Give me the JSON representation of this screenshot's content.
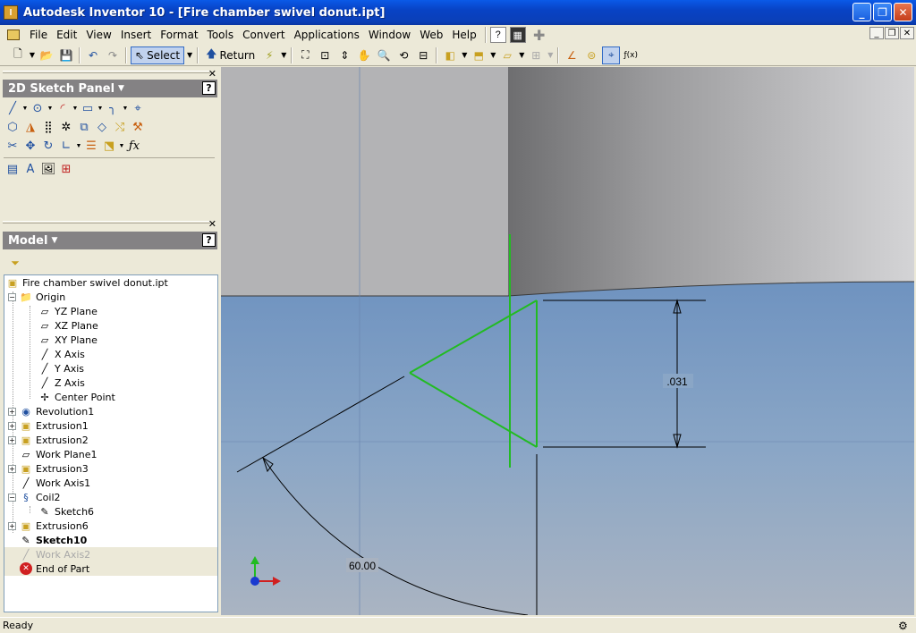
{
  "window": {
    "title": "Autodesk Inventor 10 - [Fire chamber swivel donut.ipt]",
    "controls": [
      "_",
      "❐",
      "✕"
    ]
  },
  "menu": {
    "items": [
      "File",
      "Edit",
      "View",
      "Insert",
      "Format",
      "Tools",
      "Convert",
      "Applications",
      "Window",
      "Web",
      "Help"
    ],
    "mdi_controls": [
      "_",
      "❐",
      "✕"
    ]
  },
  "toolbar": {
    "select_label": "Select",
    "return_label": "Return"
  },
  "sketch_panel": {
    "title": "2D Sketch Panel",
    "help": "?"
  },
  "model_panel": {
    "title": "Model",
    "help": "?"
  },
  "tree": [
    {
      "label": "Fire chamber swivel donut.ipt",
      "icon": "part-icon"
    },
    {
      "label": "Origin",
      "icon": "folder-icon"
    },
    {
      "label": "YZ Plane",
      "icon": "plane-icon"
    },
    {
      "label": "XZ Plane",
      "icon": "plane-icon"
    },
    {
      "label": "XY Plane",
      "icon": "plane-icon"
    },
    {
      "label": "X Axis",
      "icon": "axis-icon"
    },
    {
      "label": "Y Axis",
      "icon": "axis-icon"
    },
    {
      "label": "Z Axis",
      "icon": "axis-icon"
    },
    {
      "label": "Center Point",
      "icon": "point-icon"
    },
    {
      "label": "Revolution1",
      "icon": "revolve-icon"
    },
    {
      "label": "Extrusion1",
      "icon": "extrude-icon"
    },
    {
      "label": "Extrusion2",
      "icon": "extrude-icon"
    },
    {
      "label": "Work Plane1",
      "icon": "workplane-icon"
    },
    {
      "label": "Extrusion3",
      "icon": "extrude-icon"
    },
    {
      "label": "Work Axis1",
      "icon": "workaxis-icon"
    },
    {
      "label": "Coil2",
      "icon": "coil-icon"
    },
    {
      "label": "Sketch6",
      "icon": "sketch-icon"
    },
    {
      "label": "Extrusion6",
      "icon": "extrude-icon"
    },
    {
      "label": "Sketch10",
      "icon": "sketch-icon"
    },
    {
      "label": "Work Axis2",
      "icon": "workaxis-icon"
    },
    {
      "label": "End of Part",
      "icon": "end-of-part-icon"
    }
  ],
  "viewport": {
    "dimension_vertical": ".031",
    "dimension_angle": "60.00"
  },
  "status": {
    "text": "Ready"
  },
  "colors": {
    "sketch_green": "#22bb22",
    "face_blue": "#7d9ec2",
    "face_gray": "#a8a8aa"
  }
}
